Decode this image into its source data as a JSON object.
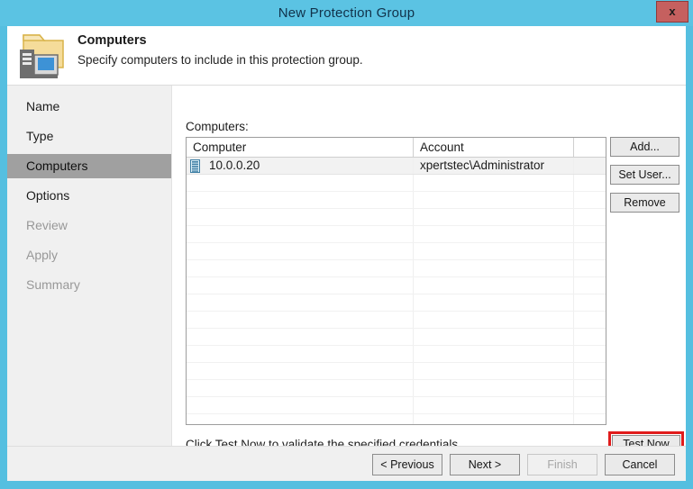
{
  "window": {
    "title": "New Protection Group",
    "close_label": "x",
    "accent_color": "#5bc3e3",
    "close_color": "#c5605f",
    "highlight_color": "#e01b1b"
  },
  "banner": {
    "icon": "folder-computers-icon",
    "heading": "Computers",
    "subtitle": "Specify computers to include in this protection group."
  },
  "sidebar": {
    "items": [
      {
        "label": "Name",
        "state": "normal"
      },
      {
        "label": "Type",
        "state": "normal"
      },
      {
        "label": "Computers",
        "state": "selected"
      },
      {
        "label": "Options",
        "state": "normal"
      },
      {
        "label": "Review",
        "state": "disabled"
      },
      {
        "label": "Apply",
        "state": "disabled"
      },
      {
        "label": "Summary",
        "state": "disabled"
      }
    ]
  },
  "main": {
    "list_label": "Computers:",
    "table": {
      "columns": [
        "Computer",
        "Account",
        ""
      ],
      "rows": [
        {
          "computer": "10.0.0.20",
          "account": "xpertstec\\Administrator",
          "extra": "",
          "icon": "server-icon",
          "selected": true
        }
      ]
    },
    "side_buttons": [
      {
        "label": "Add...",
        "name": "add-button"
      },
      {
        "label": "Set User...",
        "name": "set-user-button"
      },
      {
        "label": "Remove",
        "name": "remove-button"
      }
    ],
    "hint": "Click Test Now to validate the specified credentials.",
    "test_now_label": "Test Now"
  },
  "footer": {
    "buttons": [
      {
        "label": "< Previous",
        "state": "enabled"
      },
      {
        "label": "Next >",
        "state": "enabled"
      },
      {
        "label": "Finish",
        "state": "disabled"
      },
      {
        "label": "Cancel",
        "state": "enabled"
      }
    ]
  }
}
